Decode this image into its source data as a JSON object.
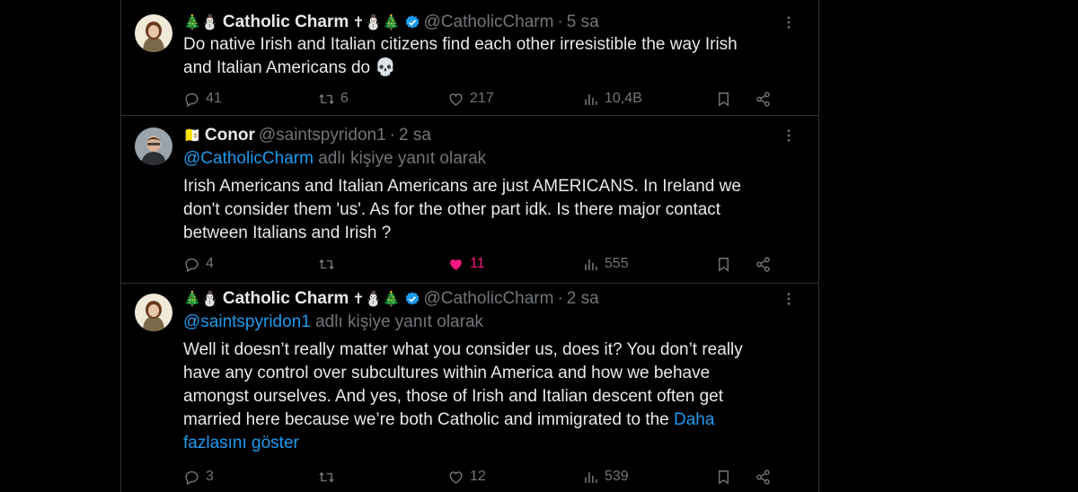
{
  "tweets": [
    {
      "name": "Catholic Charm",
      "emoji_before": "🎄⛄",
      "emoji_after": "✝⛄🎄",
      "handle": "@CatholicCharm",
      "time": "5 sa",
      "verified": true,
      "replying_to": "",
      "text": "Do native Irish and Italian citizens find each other irresistible the way Irish and Italian Americans do 💀",
      "show_more": "",
      "replies": "41",
      "reposts": "6",
      "likes": "217",
      "views": "10,4B",
      "liked": false
    },
    {
      "name": "Conor",
      "emoji_before": "🇻🇦",
      "emoji_after": "",
      "handle": "@saintspyridon1",
      "time": "2 sa",
      "verified": false,
      "replying_to": "@CatholicCharm",
      "replying_suffix": " adlı kişiye yanıt olarak",
      "text": "Irish Americans and Italian Americans are just  AMERICANS.  In Ireland we don't consider them 'us'. As for the other part idk. Is there major contact between Italians and Irish ?",
      "show_more": "",
      "replies": "4",
      "reposts": "",
      "likes": "11",
      "views": "555",
      "liked": true
    },
    {
      "name": "Catholic Charm",
      "emoji_before": "🎄⛄",
      "emoji_after": "✝⛄🎄",
      "handle": "@CatholicCharm",
      "time": "2 sa",
      "verified": true,
      "replying_to": "@saintspyridon1",
      "replying_suffix": " adlı kişiye yanıt olarak",
      "text": "Well it doesn’t really matter what you consider us, does it? You don’t really have any control over subcultures within America and how we behave amongst ourselves. And yes, those of Irish and Italian descent often get married here because we’re both Catholic and immigrated to the ",
      "show_more": "Daha fazlasını göster",
      "replies": "3",
      "reposts": "",
      "likes": "12",
      "views": "539",
      "liked": false
    }
  ],
  "separator": "·",
  "colors": {
    "background": "#000000",
    "text": "#e7e9ea",
    "muted": "#71767b",
    "link": "#1d9bf0",
    "like": "#f91880",
    "border": "#2f3336"
  },
  "icons": [
    "more-icon",
    "verified-icon",
    "reply-icon",
    "repost-icon",
    "like-icon",
    "views-icon",
    "bookmark-icon",
    "share-icon"
  ]
}
